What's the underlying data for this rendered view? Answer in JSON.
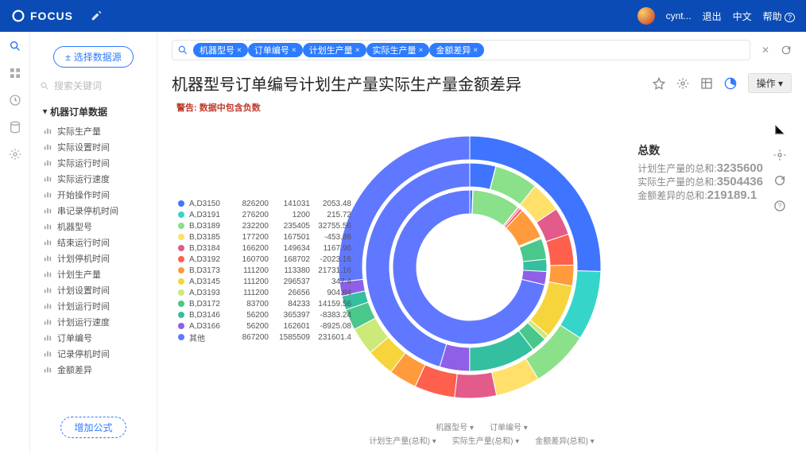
{
  "app": {
    "name": "FOCUS"
  },
  "user": {
    "name": "cynt...",
    "logout": "退出",
    "lang": "中文",
    "help": "帮助"
  },
  "sidebar": {
    "datasource_btn": "选择数据源",
    "search_placeholder": "搜索关键词",
    "tree_title": "机器订单数据",
    "items": [
      {
        "label": "实际生产量"
      },
      {
        "label": "实际设置时间"
      },
      {
        "label": "实际运行时间"
      },
      {
        "label": "实际运行速度"
      },
      {
        "label": "开始操作时间"
      },
      {
        "label": "串记录停机时间"
      },
      {
        "label": "机器型号"
      },
      {
        "label": "结束运行时间"
      },
      {
        "label": "计划停机时间"
      },
      {
        "label": "计划生产量"
      },
      {
        "label": "计划设置时间"
      },
      {
        "label": "计划运行时间"
      },
      {
        "label": "计划运行速度"
      },
      {
        "label": "订单编号"
      },
      {
        "label": "记录停机时间"
      },
      {
        "label": "金额差异"
      }
    ],
    "add_formula": "增加公式"
  },
  "query": {
    "chips": [
      "机器型号",
      "订单编号",
      "计划生产量",
      "实际生产量",
      "金额差异"
    ]
  },
  "title": "机器型号订单编号计划生产量实际生产量金额差异",
  "op_btn": "操作",
  "warning": "警告: 数据中包含负数",
  "summary": {
    "heading": "总数",
    "rows": [
      {
        "label": "计划生产量的总和:",
        "value": "3235600"
      },
      {
        "label": "实际生产量的总和:",
        "value": "3504436"
      },
      {
        "label": "金额差异的总和:",
        "value": "219189.1"
      }
    ]
  },
  "foot": {
    "r1": "机器型号 ▾　　订单编号 ▾",
    "r2": "计划生产量(总和) ▾　　实际生产量(总和) ▾　　金额差异(总和) ▾"
  },
  "chart_data": {
    "type": "pie",
    "title": "机器型号订单编号计划生产量实际生产量金额差异",
    "rings": [
      "计划生产量(总和)",
      "实际生产量(总和)",
      "金额差异(总和)"
    ],
    "series": [
      {
        "name": "A,D3150",
        "color": "#3f74ff",
        "values": [
          826200,
          141031,
          2053.48
        ]
      },
      {
        "name": "A,D3191",
        "color": "#35d6c9",
        "values": [
          276200,
          1200,
          215.72
        ]
      },
      {
        "name": "B,D3189",
        "color": "#8be08a",
        "values": [
          232200,
          235405,
          32755.56
        ]
      },
      {
        "name": "B,D3185",
        "color": "#ffe06b",
        "values": [
          177200,
          167501,
          -453.88
        ]
      },
      {
        "name": "B,D3184",
        "color": "#e25b8a",
        "values": [
          166200,
          149634,
          1167.96
        ]
      },
      {
        "name": "A,D3192",
        "color": "#ff5f4d",
        "values": [
          160700,
          168702,
          -2023.16
        ]
      },
      {
        "name": "B,D3173",
        "color": "#ff9b3d",
        "values": [
          111200,
          113380,
          21731.16
        ]
      },
      {
        "name": "A,D3145",
        "color": "#f6d53c",
        "values": [
          111200,
          296537,
          347.4
        ]
      },
      {
        "name": "A,D3193",
        "color": "#cde97a",
        "values": [
          111200,
          26656,
          904.84
        ]
      },
      {
        "name": "B,D3172",
        "color": "#4ac78a",
        "values": [
          83700,
          84233,
          14159.56
        ]
      },
      {
        "name": "B,D3146",
        "color": "#33bfa0",
        "values": [
          56200,
          365397,
          -8383.24
        ]
      },
      {
        "name": "A,D3166",
        "color": "#8f5fe8",
        "values": [
          56200,
          162601,
          -8925.08
        ]
      },
      {
        "name": "其他",
        "color": "#6078ff",
        "values": [
          867200,
          1585509,
          231601.4
        ]
      }
    ],
    "totals": {
      "计划生产量": 3235600,
      "实际生产量": 3504436,
      "金额差异": 219189.1
    }
  }
}
